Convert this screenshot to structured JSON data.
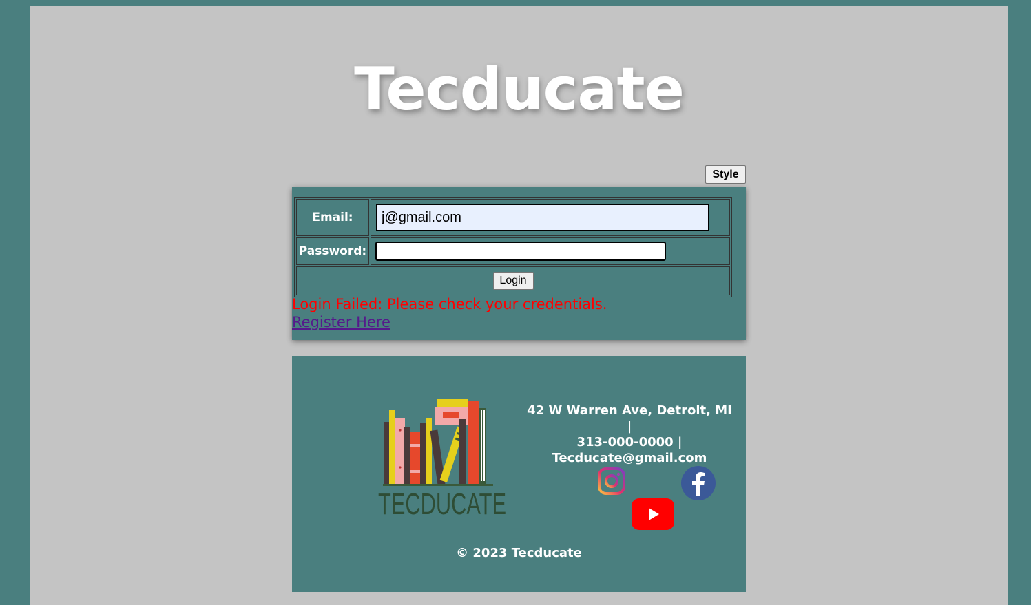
{
  "site": {
    "title": "Tecducate"
  },
  "toolbar": {
    "style_label": "Style"
  },
  "login_form": {
    "email_label": "Email:",
    "email_value": "j@gmail.com",
    "password_label": "Password:",
    "password_value": "",
    "login_label": "Login",
    "error_message": "Login Failed: Please check your credentials.",
    "register_link": "Register Here"
  },
  "footer": {
    "logo_text": "TECDUCATE",
    "contact_lines": [
      "42 W Warren Ave, Detroit, MI |",
      "313-000-0000 |",
      "Tecducate@gmail.com"
    ],
    "social_icons": [
      "instagram-icon",
      "facebook-icon",
      "youtube-icon"
    ],
    "copyright": "© 2023 Tecducate"
  },
  "colors": {
    "outer_background": "#4a7f7f",
    "page_background": "#c4c4c4",
    "panel_background": "#4a7f7f",
    "error_text": "#ff0000",
    "link_text": "#551a8b"
  }
}
